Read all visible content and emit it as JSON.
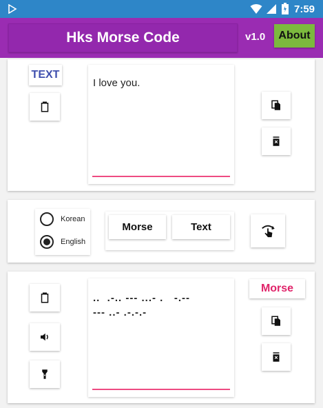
{
  "status_bar": {
    "time": "7:59"
  },
  "app_bar": {
    "title": "Hks Morse Code",
    "version": "v1.0",
    "about_label": "About"
  },
  "text_panel": {
    "label": "TEXT",
    "value": "I love you."
  },
  "controls": {
    "radio_options": [
      "Korean",
      "English"
    ],
    "selected": "English",
    "morse_label": "Morse",
    "text_label": "Text"
  },
  "morse_panel": {
    "label": "Morse",
    "value": "..  .-.. --- ...- .   -.--\n--- ..- .-.-.-"
  },
  "colors": {
    "status_bar": "#2e86c8",
    "app_bar": "#9a2cb2",
    "about_button": "#7cb93e",
    "text_label": "#3f4fae",
    "morse_label": "#e0246a",
    "underline": "#ee4b82"
  }
}
